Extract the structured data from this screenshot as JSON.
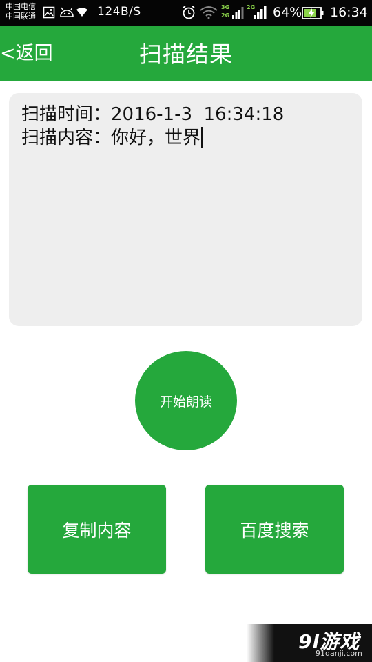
{
  "status_bar": {
    "carrier_1": "中国电信",
    "carrier_2": "中国联通",
    "speed": "124B/S",
    "net_1": "3G",
    "net_1b": "2G",
    "net_2": "2G",
    "battery": "64%",
    "time": "16:34"
  },
  "header": {
    "back_label": "<返回",
    "title": "扫描结果"
  },
  "result": {
    "scan_time_line": "扫描时间：2016-1-3  16:34:18",
    "scan_content_line": "扫描内容：你好，世界"
  },
  "buttons": {
    "read_aloud": "开始朗读",
    "copy": "复制内容",
    "search": "百度搜索"
  },
  "watermark": {
    "brand": "9l游戏",
    "url": "91danji.com"
  },
  "colors": {
    "accent": "#25a83c",
    "status_bar": "#050505",
    "text_area": "#eeeeee"
  }
}
